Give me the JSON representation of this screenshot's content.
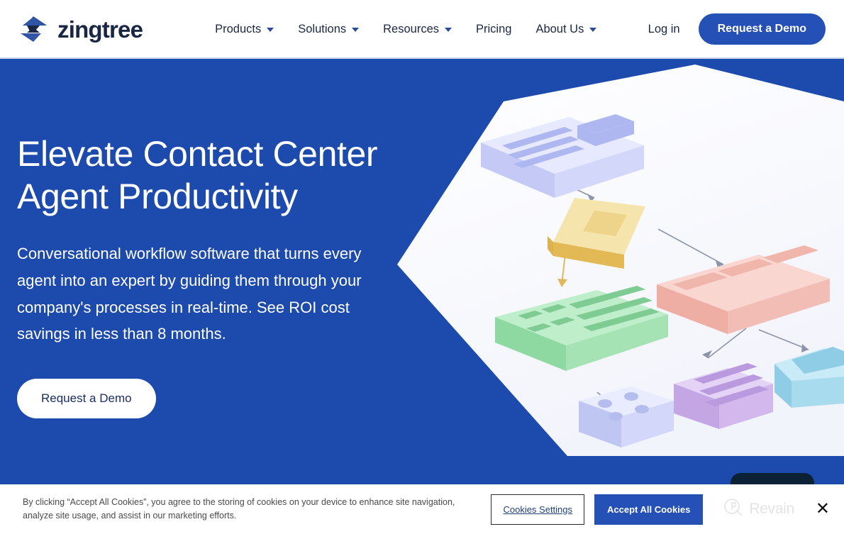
{
  "header": {
    "brand": {
      "name": "zingtree",
      "logo_icon": "zingtree-arrows-logo"
    },
    "nav": [
      {
        "label": "Products",
        "has_dropdown": true
      },
      {
        "label": "Solutions",
        "has_dropdown": true
      },
      {
        "label": "Resources",
        "has_dropdown": true
      },
      {
        "label": "Pricing",
        "has_dropdown": false
      },
      {
        "label": "About Us",
        "has_dropdown": true
      }
    ],
    "login_label": "Log in",
    "demo_button_label": "Request a Demo"
  },
  "hero": {
    "title": "Elevate Contact Center Agent Productivity",
    "subtitle": "Conversational workflow software that turns every agent into an expert by guiding them through your company's processes in real-time. See ROI cost savings in less than 8 months.",
    "cta_label": "Request a Demo",
    "background_color": "#1d4aad",
    "illustration": {
      "name": "isometric-decision-tree-illustration",
      "plane_color": "#ffffff",
      "nodes": [
        {
          "id": "node-top",
          "shape": "slab",
          "color": "#c8cdf7",
          "top_color": "#e8eaff",
          "detail": "three-bars-and-panel"
        },
        {
          "id": "node-decision",
          "shape": "diamond",
          "color": "#e8c068",
          "top_color": "#f7e3a8",
          "detail": "inner-diamond"
        },
        {
          "id": "node-green",
          "shape": "slab",
          "color": "#8fdba0",
          "top_color": "#b9ecc4",
          "detail": "four-squares-and-three-bars"
        },
        {
          "id": "node-red",
          "shape": "slab",
          "color": "#f0b6ad",
          "top_color": "#f8d4ce",
          "detail": "three-panels"
        },
        {
          "id": "node-dots",
          "shape": "cube",
          "color": "#c3c9f5",
          "top_color": "#e4e7ff",
          "detail": "four-dots"
        },
        {
          "id": "node-purple",
          "shape": "cube",
          "color": "#cdb3e8",
          "top_color": "#e4d3f5",
          "detail": "three-bars"
        },
        {
          "id": "node-blue",
          "shape": "cube",
          "color": "#9fd7ef",
          "top_color": "#c8ebf9",
          "detail": "inner-panel"
        }
      ],
      "connectors": 5
    }
  },
  "cookie_banner": {
    "message": "By clicking “Accept All Cookies”, you agree to the storing of cookies on your device to enhance site navigation, analyze site usage, and assist in our marketing efforts.",
    "settings_label": "Cookies Settings",
    "accept_label": "Accept All Cookies",
    "close_icon_glyph": "✕"
  },
  "watermark": {
    "text": "Revain",
    "icon": "revain-logo-icon"
  },
  "chat_widget": {
    "name": "chat-launcher",
    "color": "#0d2136"
  }
}
